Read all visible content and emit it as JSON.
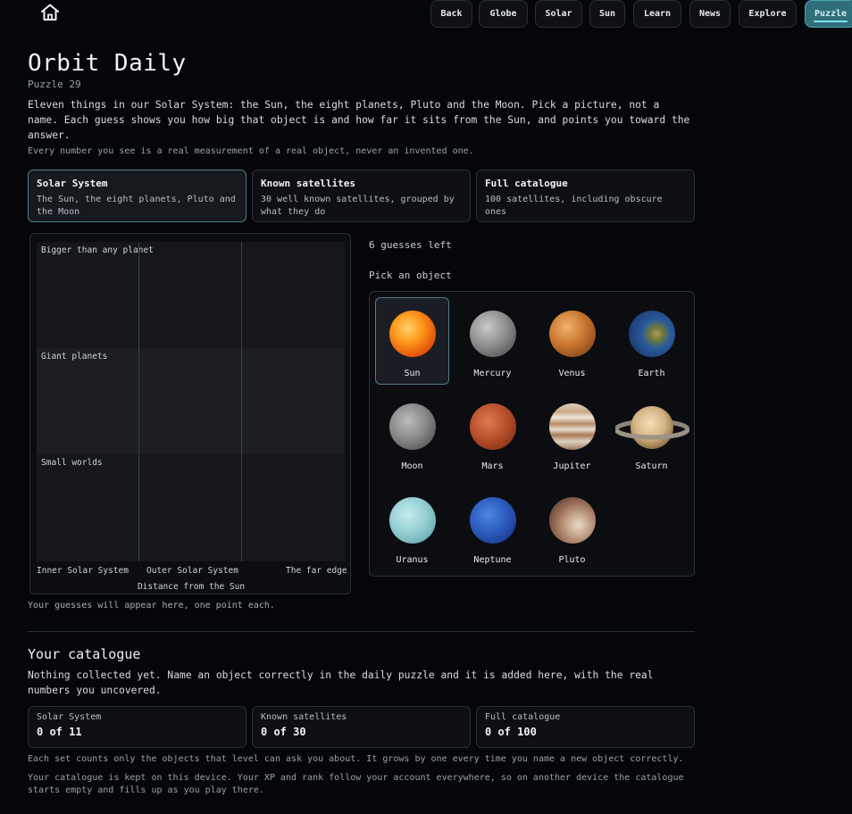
{
  "nav": {
    "home_icon": "home-icon",
    "items": [
      {
        "label": "Back"
      },
      {
        "label": "Globe"
      },
      {
        "label": "Solar"
      },
      {
        "label": "Sun"
      },
      {
        "label": "Learn"
      },
      {
        "label": "News"
      },
      {
        "label": "Explore"
      },
      {
        "label": "Puzzle",
        "active": true
      }
    ]
  },
  "header": {
    "title": "Orbit Daily",
    "puzzle_number": "Puzzle 29",
    "intro": "Eleven things in our Solar System: the Sun, the eight planets, Pluto and the Moon. Pick a picture, not a name. Each guess shows you how big that object is and how far it sits from the Sun, and points you toward the answer.",
    "note": "Every number you see is a real measurement of a real object, never an invented one."
  },
  "tiers": [
    {
      "name": "Solar System",
      "desc": "The Sun, the eight planets, Pluto and the Moon",
      "active": true
    },
    {
      "name": "Known satellites",
      "desc": "30 well known satellites, grouped by what they do",
      "active": false
    },
    {
      "name": "Full catalogue",
      "desc": "100 satellites, including obscure ones",
      "active": false
    }
  ],
  "chart": {
    "bands": [
      "Bigger than any planet",
      "Giant planets",
      "Small worlds"
    ],
    "x_categories": [
      "Inner Solar System",
      "Outer Solar System",
      "The far edge"
    ],
    "x_label": "Distance from the Sun",
    "hint": "Your guesses will appear here, one point each."
  },
  "game": {
    "guesses_left": "6 guesses left",
    "pick_label": "Pick an object",
    "objects": [
      {
        "name": "Sun",
        "selected": true
      },
      {
        "name": "Mercury"
      },
      {
        "name": "Venus"
      },
      {
        "name": "Earth"
      },
      {
        "name": "Moon"
      },
      {
        "name": "Mars"
      },
      {
        "name": "Jupiter"
      },
      {
        "name": "Saturn"
      },
      {
        "name": "Uranus"
      },
      {
        "name": "Neptune"
      },
      {
        "name": "Pluto"
      }
    ]
  },
  "catalogue": {
    "title": "Your catalogue",
    "desc": "Nothing collected yet. Name an object correctly in the daily puzzle and it is added here, with the real numbers you uncovered.",
    "counts": [
      {
        "label": "Solar System",
        "value": "0 of 11"
      },
      {
        "label": "Known satellites",
        "value": "0 of 30"
      },
      {
        "label": "Full catalogue",
        "value": "0 of 100"
      }
    ],
    "footnote1": "Each set counts only the objects that level can ask you about. It grows by one every time you name a new object correctly.",
    "footnote2": "Your catalogue is kept on this device. Your XP and rank follow your account everywhere, so on another device the catalogue starts empty and fills up as you play there."
  }
}
